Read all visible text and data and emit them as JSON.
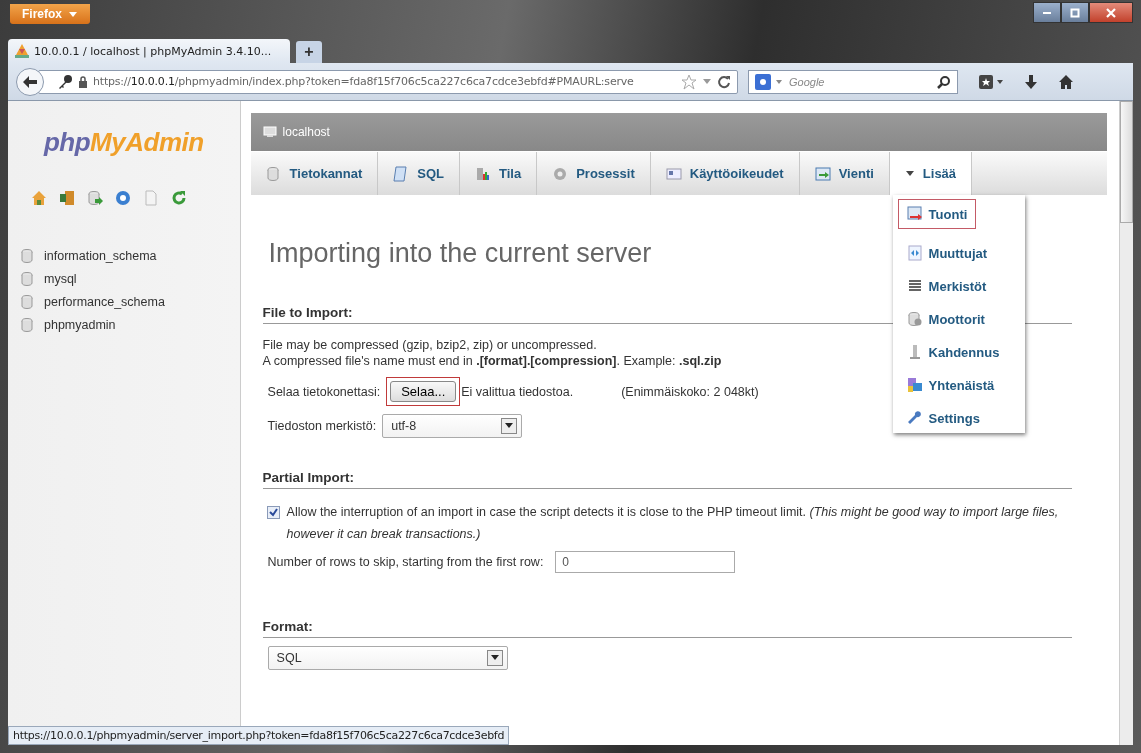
{
  "browser": {
    "app_button": "Firefox",
    "tab": {
      "title": "10.0.0.1 / localhost | phpMyAdmin 3.4.10...",
      "selected": true
    },
    "new_tab": "+",
    "url": {
      "scheme": "https://",
      "host": "10.0.0.1",
      "path": "/phpmyadmin/index.php?token=fda8f15f706c5ca227c6ca7cdce3ebfd#PMAURL:serve"
    },
    "search": {
      "placeholder": "Google"
    }
  },
  "sidebar": {
    "logo": {
      "first": "php",
      "second": "MyAdmin"
    },
    "databases": [
      {
        "name": "information_schema"
      },
      {
        "name": "mysql"
      },
      {
        "name": "performance_schema"
      },
      {
        "name": "phpmyadmin"
      }
    ]
  },
  "server_bar": {
    "title": "localhost"
  },
  "tabs": [
    {
      "label": "Tietokannat",
      "selected": false
    },
    {
      "label": "SQL",
      "selected": false
    },
    {
      "label": "Tila",
      "selected": false
    },
    {
      "label": "Prosessit",
      "selected": false
    },
    {
      "label": "Käyttöoikeudet",
      "selected": false
    },
    {
      "label": "Vienti",
      "selected": false
    },
    {
      "label": "Lisää",
      "selected": true,
      "kind": "menu"
    }
  ],
  "more_menu": {
    "items": [
      {
        "label": "Tuonti",
        "selected": true
      },
      {
        "label": "Muuttujat",
        "selected": false
      },
      {
        "label": "Merkistöt",
        "selected": false
      },
      {
        "label": "Moottorit",
        "selected": false
      },
      {
        "label": "Kahdennus",
        "selected": false
      },
      {
        "label": "Yhtenäistä",
        "selected": false
      },
      {
        "label": "Settings",
        "selected": false
      }
    ]
  },
  "page": {
    "title": "Importing into the current server",
    "file_section": {
      "heading": "File to Import:",
      "notes": [
        "File may be compressed (gzip, bzip2, zip) or uncompressed.",
        "A compressed file's name must end in **.[format].[compression]**. Example: **.sql.zip**"
      ],
      "browse": {
        "label": "Selaa tietokonettasi:",
        "button": "Selaa...",
        "highlighted": true,
        "file": "Ei valittua tiedostoa.",
        "limit": "(Enimmäiskoko: 2 048kt)"
      },
      "charset": {
        "label": "Tiedoston merkistö:",
        "value": "utf-8"
      }
    },
    "partial_section": {
      "heading": "Partial Import:",
      "allow": {
        "checked": true,
        "text": "Allow the interruption of an import in case the script detects it is close to the PHP timeout limit. *(This might be good way to import large files, however it can break transactions.)*"
      },
      "skip": {
        "label": "Number of rows to skip, starting from the first row:",
        "value": "0"
      }
    },
    "format_section": {
      "heading": "Format:",
      "value": "SQL"
    }
  },
  "status_bar": {
    "text": "https://10.0.0.1/phpmyadmin/server_import.php?token=fda8f15f706c5ca227c6ca7cdce3ebfd"
  }
}
